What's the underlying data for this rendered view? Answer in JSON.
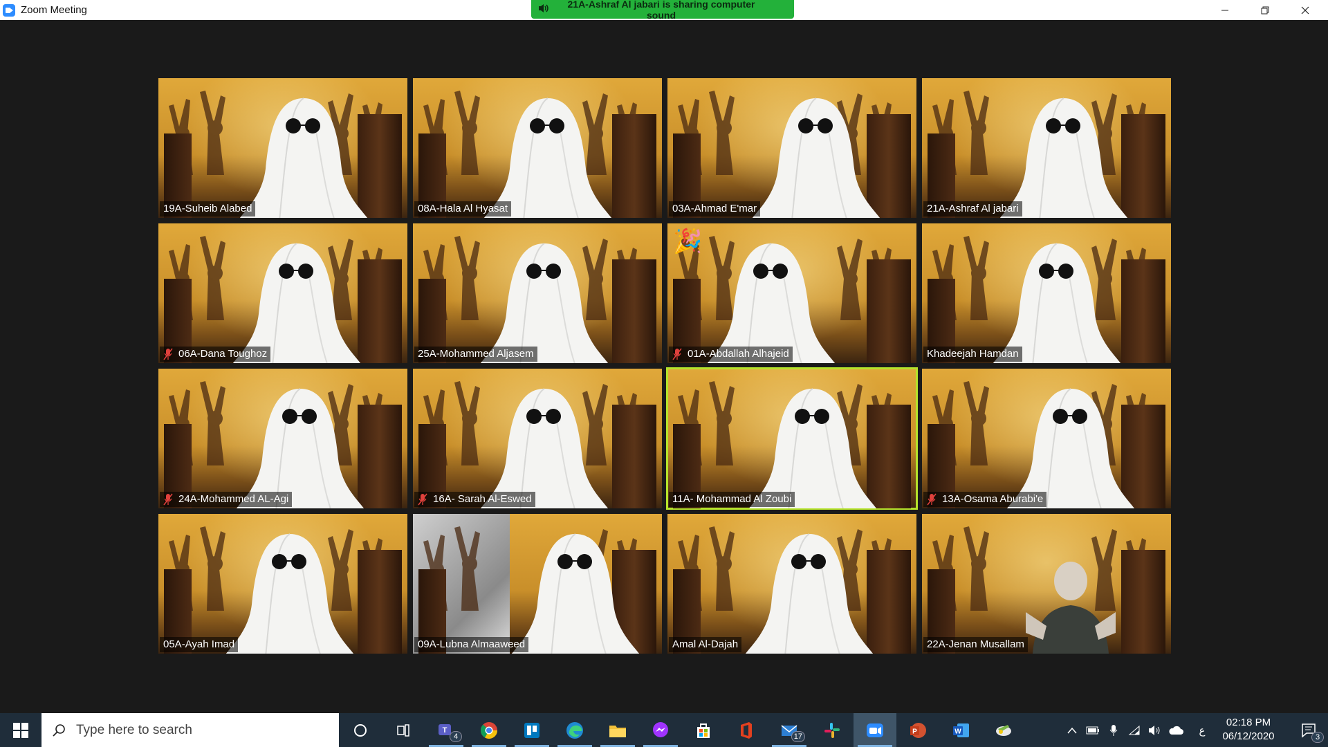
{
  "window": {
    "title": "Zoom Meeting",
    "sharing_banner": "21A-Ashraf Al jabari is sharing computer sound"
  },
  "participants": [
    {
      "name": "19A-Suheib Alabed",
      "muted": false,
      "speaking": false
    },
    {
      "name": "08A-Hala Al Hyasat",
      "muted": false,
      "speaking": false
    },
    {
      "name": "03A-Ahmad E'mar",
      "muted": false,
      "speaking": false
    },
    {
      "name": "21A-Ashraf Al jabari",
      "muted": false,
      "speaking": false
    },
    {
      "name": "06A-Dana Toughoz",
      "muted": true,
      "speaking": false
    },
    {
      "name": "25A-Mohammed Aljasem",
      "muted": false,
      "speaking": false
    },
    {
      "name": "01A-Abdallah Alhajeid",
      "muted": true,
      "speaking": false,
      "reaction": "🎉"
    },
    {
      "name": "Khadeejah Hamdan",
      "muted": false,
      "speaking": false
    },
    {
      "name": "24A-Mohammed AL-Agi",
      "muted": true,
      "speaking": false
    },
    {
      "name": "16A- Sarah Al-Eswed",
      "muted": true,
      "speaking": false
    },
    {
      "name": "11A- Mohammad Al Zoubi",
      "muted": false,
      "speaking": true
    },
    {
      "name": "13A-Osama Aburabi'e",
      "muted": true,
      "speaking": false
    },
    {
      "name": "05A-Ayah Imad",
      "muted": false,
      "speaking": false
    },
    {
      "name": "09A-Lubna Almaaweed",
      "muted": false,
      "speaking": false
    },
    {
      "name": "Amal Al-Dajah",
      "muted": false,
      "speaking": false
    },
    {
      "name": "22A-Jenan Musallam",
      "muted": false,
      "speaking": false
    }
  ],
  "taskbar": {
    "search_placeholder": "Type here to search",
    "apps": [
      {
        "icon": "teams-icon",
        "badge": "4"
      },
      {
        "icon": "chrome-icon"
      },
      {
        "icon": "trello-icon"
      },
      {
        "icon": "edge-icon"
      },
      {
        "icon": "file-explorer-icon"
      },
      {
        "icon": "messenger-icon"
      },
      {
        "icon": "store-icon"
      },
      {
        "icon": "office-icon"
      },
      {
        "icon": "mail-icon",
        "badge": "17"
      },
      {
        "icon": "slack-icon"
      },
      {
        "icon": "zoom-icon"
      },
      {
        "icon": "powerpoint-icon"
      },
      {
        "icon": "word-icon"
      },
      {
        "icon": "whiteboard-icon"
      }
    ],
    "tray": {
      "language": "ع",
      "time": "02:18 PM",
      "date": "06/12/2020",
      "notification_count": "3"
    }
  }
}
